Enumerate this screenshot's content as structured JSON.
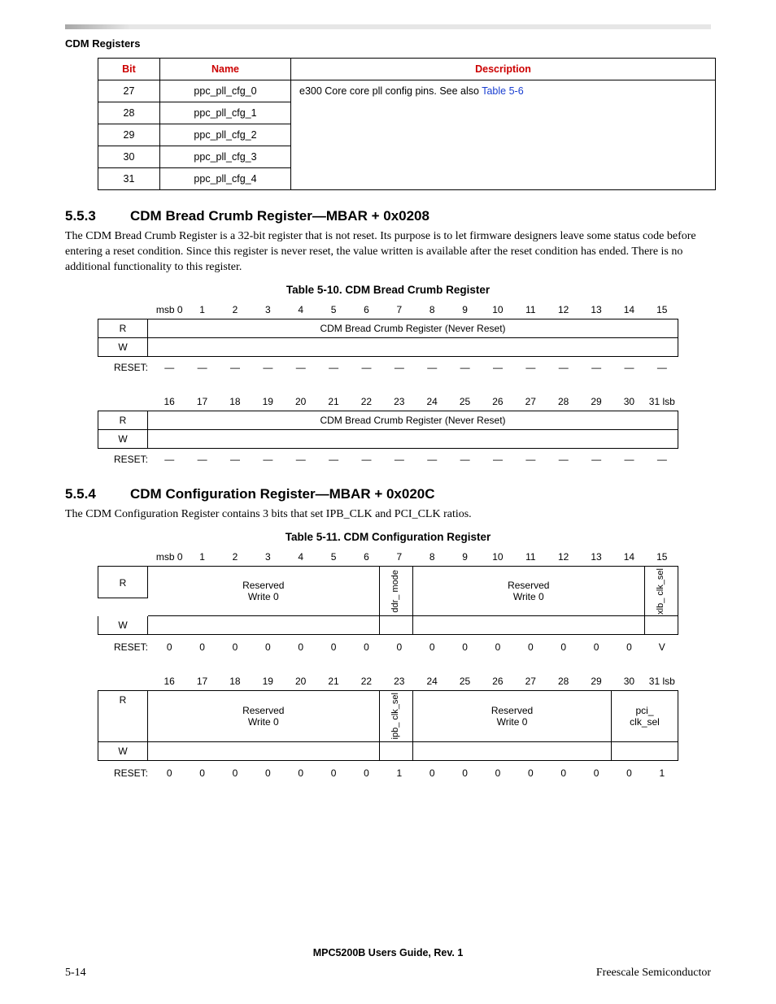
{
  "header": {
    "sectionTitle": "CDM Registers"
  },
  "table1": {
    "headers": {
      "bit": "Bit",
      "name": "Name",
      "desc": "Description"
    },
    "descPrefix": "e300 Core core pll config pins. See also ",
    "descLink": "Table 5-6",
    "rows": [
      {
        "bit": "27",
        "name": "ppc_pll_cfg_0"
      },
      {
        "bit": "28",
        "name": "ppc_pll_cfg_1"
      },
      {
        "bit": "29",
        "name": "ppc_pll_cfg_2"
      },
      {
        "bit": "30",
        "name": "ppc_pll_cfg_3"
      },
      {
        "bit": "31",
        "name": "ppc_pll_cfg_4"
      }
    ]
  },
  "sec553": {
    "num": "5.5.3",
    "title": "CDM Bread Crumb Register—MBAR + 0x0208",
    "para": "The CDM Bread Crumb Register is a 32-bit register that is not reset. Its purpose is to let firmware designers leave some status code before entering a reset condition. Since this register is never reset, the value written is available after the reset condition has ended. There is no additional functionality to this register.",
    "tabTitle": "Table 5-10. CDM Bread Crumb Register"
  },
  "reg510": {
    "topBits": [
      "msb 0",
      "1",
      "2",
      "3",
      "4",
      "5",
      "6",
      "7",
      "8",
      "9",
      "10",
      "11",
      "12",
      "13",
      "14",
      "15"
    ],
    "botBits": [
      "16",
      "17",
      "18",
      "19",
      "20",
      "21",
      "22",
      "23",
      "24",
      "25",
      "26",
      "27",
      "28",
      "29",
      "30",
      "31 lsb"
    ],
    "rLabel": "R",
    "wLabel": "W",
    "resetLabel": "RESET:",
    "resetDash": "—",
    "rText": "CDM Bread Crumb Register (Never Reset)"
  },
  "sec554": {
    "num": "5.5.4",
    "title": "CDM Configuration Register—MBAR + 0x020C",
    "para": "The CDM Configuration Register contains 3 bits that set IPB_CLK and PCI_CLK ratios.",
    "tabTitle": "Table 5-11. CDM Configuration Register"
  },
  "reg511": {
    "topBits": [
      "msb 0",
      "1",
      "2",
      "3",
      "4",
      "5",
      "6",
      "7",
      "8",
      "9",
      "10",
      "11",
      "12",
      "13",
      "14",
      "15"
    ],
    "botBits": [
      "16",
      "17",
      "18",
      "19",
      "20",
      "21",
      "22",
      "23",
      "24",
      "25",
      "26",
      "27",
      "28",
      "29",
      "30",
      "31 lsb"
    ],
    "rLabel": "R",
    "wLabel": "W",
    "resetLabel": "RESET:",
    "reserved1": "Reserved",
    "write0": "Write 0",
    "ddrMode": "ddr_\nmode",
    "xlbClkSel": "xlb_\nclk_sel",
    "ipbClkSel": "ipb_\nclk_sel",
    "pciClkSel1": "pci_",
    "pciClkSel2": "clk_sel",
    "resetTop": [
      "0",
      "0",
      "0",
      "0",
      "0",
      "0",
      "0",
      "0",
      "0",
      "0",
      "0",
      "0",
      "0",
      "0",
      "0",
      "V"
    ],
    "resetBot": [
      "0",
      "0",
      "0",
      "0",
      "0",
      "0",
      "0",
      "1",
      "0",
      "0",
      "0",
      "0",
      "0",
      "0",
      "0",
      "1"
    ]
  },
  "footer": {
    "center": "MPC5200B Users Guide, Rev. 1",
    "left": "5-14",
    "right": "Freescale Semiconductor"
  }
}
